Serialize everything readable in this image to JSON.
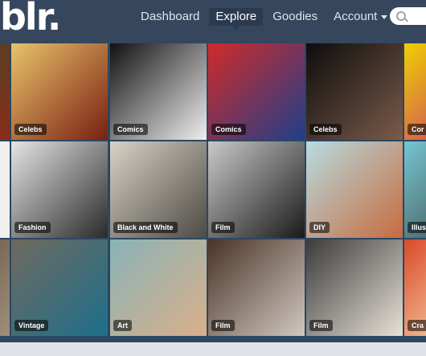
{
  "header": {
    "logo": "blr.",
    "nav": [
      {
        "label": "Dashboard"
      },
      {
        "label": "Explore"
      },
      {
        "label": "Goodies"
      },
      {
        "label": "Account"
      }
    ]
  },
  "tiles": [
    {
      "label": "Celebs",
      "c1": "#e8c36a",
      "c2": "#7a1f12"
    },
    {
      "label": "Comics",
      "c1": "#111111",
      "c2": "#efefef"
    },
    {
      "label": "Comics",
      "c1": "#d12a2a",
      "c2": "#1f3f8a"
    },
    {
      "label": "Celebs",
      "c1": "#0d0d0d",
      "c2": "#7b5b4a"
    },
    {
      "label": "Cor",
      "c1": "#f0d000",
      "c2": "#c02080"
    },
    {
      "label": "Fashion",
      "c1": "#e5e5e5",
      "c2": "#2a2a2a"
    },
    {
      "label": "Black and White",
      "c1": "#d8d2c6",
      "c2": "#4d4a44"
    },
    {
      "label": "Film",
      "c1": "#c9c9c9",
      "c2": "#1a1a1a"
    },
    {
      "label": "DIY",
      "c1": "#b7dbe0",
      "c2": "#c76b3f"
    },
    {
      "label": "Illus",
      "c1": "#74c6d1",
      "c2": "#3b3b3b"
    },
    {
      "label": "Vintage",
      "c1": "#6f6a5e",
      "c2": "#1d6f8c"
    },
    {
      "label": "Art",
      "c1": "#89b3b8",
      "c2": "#d9b08a"
    },
    {
      "label": "Film",
      "c1": "#4a3426",
      "c2": "#cfc7c0"
    },
    {
      "label": "Film",
      "c1": "#3b3b3b",
      "c2": "#e7e1d7"
    },
    {
      "label": "Cra",
      "c1": "#d94a2b",
      "c2": "#fff3c8"
    }
  ]
}
